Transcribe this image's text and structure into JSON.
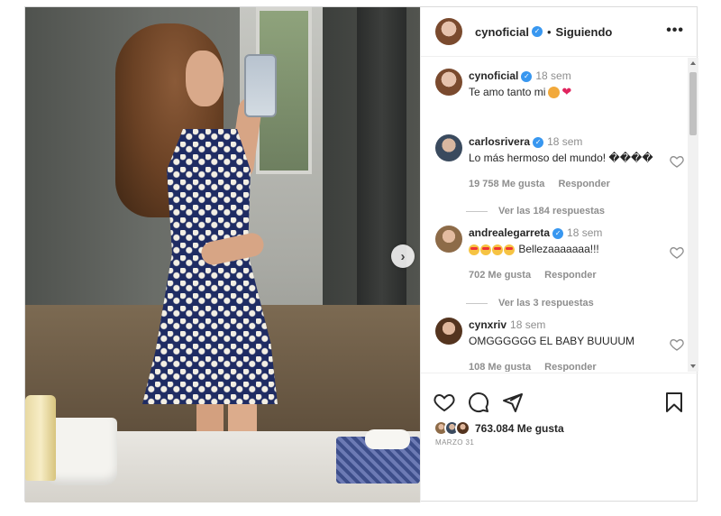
{
  "post": {
    "author": "cynoficial",
    "following_label": "Siguiendo",
    "dot": "•",
    "more_label": "•••",
    "next_label": "›"
  },
  "caption": {
    "user": "cynoficial",
    "time": "18 sem",
    "text": "Te amo tanto mi",
    "heart": "❤"
  },
  "comments": [
    {
      "user": "carlosrivera",
      "verified": true,
      "time": "18 sem",
      "text": "Lo más hermoso del mundo! ����",
      "likes": "19 758 Me gusta",
      "reply": "Responder",
      "replies": "Ver las 184 respuestas"
    },
    {
      "user": "andrealegarreta",
      "verified": true,
      "time": "18 sem",
      "text": "Bellezaaaaaaa!!!",
      "likes": "702 Me gusta",
      "reply": "Responder",
      "replies": "Ver las 3 respuestas"
    },
    {
      "user": "cynxriv",
      "verified": false,
      "time": "18 sem",
      "text": "OMGGGGGG EL BABY BUUUUM",
      "likes": "108 Me gusta",
      "reply": "Responder"
    }
  ],
  "footer": {
    "likes": "763.084 Me gusta",
    "date": "MARZO 31"
  },
  "icons": [
    "heart-icon",
    "comment-icon",
    "share-icon",
    "bookmark-icon",
    "verified-icon",
    "chevron-right-icon"
  ],
  "colors": {
    "verified": "#3897f0",
    "muted": "#8e8e8e",
    "text": "#262626",
    "heart": "#e0245e"
  }
}
